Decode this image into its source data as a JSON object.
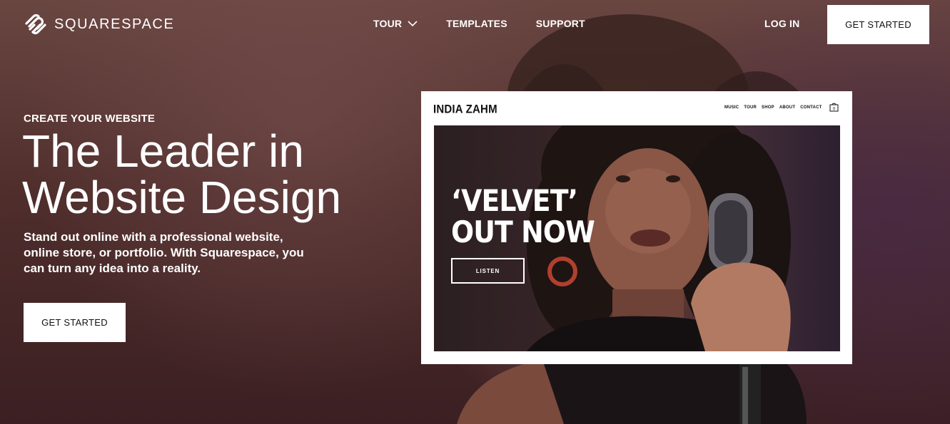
{
  "header": {
    "brand": "SQUARESPACE",
    "nav": [
      {
        "label": "TOUR",
        "has_dropdown": true
      },
      {
        "label": "TEMPLATES",
        "has_dropdown": false
      },
      {
        "label": "SUPPORT",
        "has_dropdown": false
      }
    ],
    "login_label": "LOG IN",
    "cta_label": "GET STARTED"
  },
  "hero": {
    "eyebrow": "CREATE YOUR WEBSITE",
    "headline_line1": "The Leader in",
    "headline_line2": "Website Design",
    "subtext": "Stand out online with a professional website, online store, or portfolio. With Squarespace, you can turn any idea into a reality.",
    "cta_label": "GET STARTED"
  },
  "mockup": {
    "site_title": "INDIA ZAHM",
    "nav": [
      "MUSIC",
      "TOUR",
      "SHOP",
      "ABOUT",
      "CONTACT"
    ],
    "cart_count": "0",
    "headline_line1": "‘VELVET’",
    "headline_line2": "OUT NOW",
    "button_label": "LISTEN"
  },
  "colors": {
    "background": "#4f2e2c",
    "button_bg": "#ffffff",
    "button_text": "#111111"
  },
  "icons": [
    "squarespace-logo-icon",
    "chevron-down-icon",
    "shopping-bag-icon"
  ]
}
